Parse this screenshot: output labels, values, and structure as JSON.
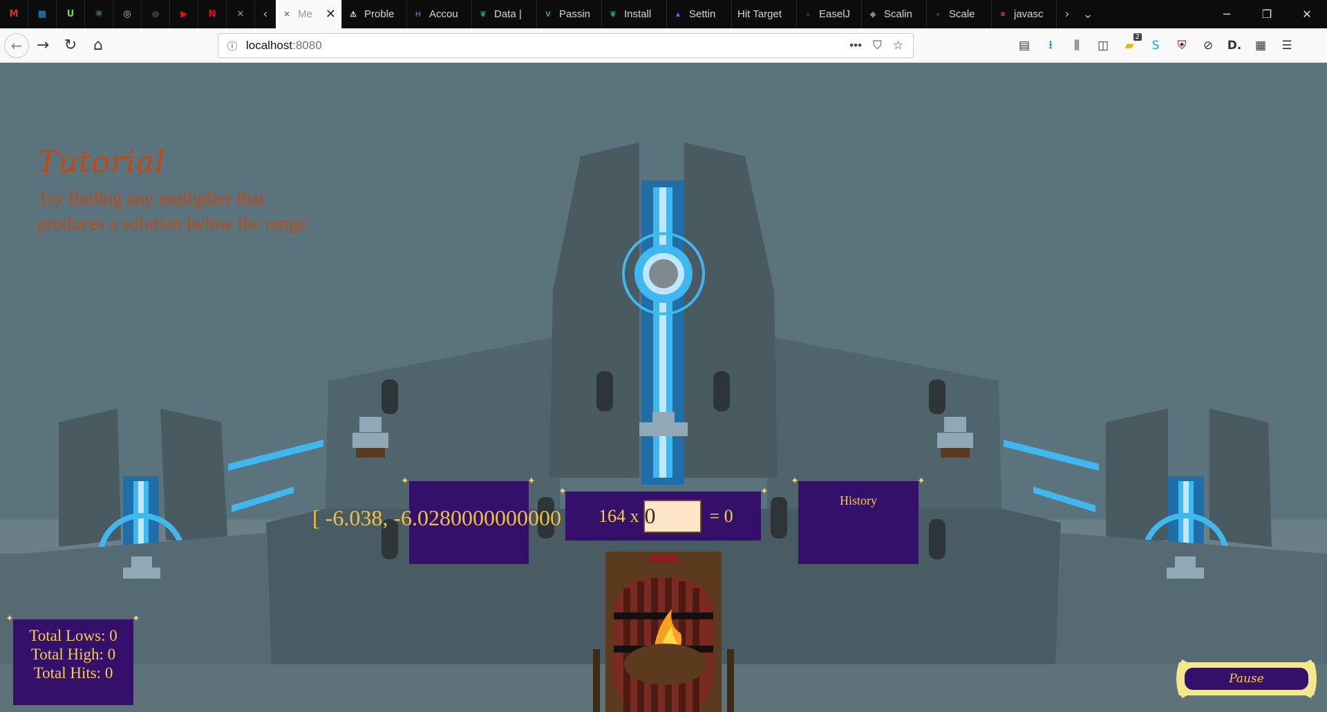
{
  "browser": {
    "pinned_tabs": [
      {
        "name": "gmail",
        "icon": "gmail-icon",
        "color": "#d93025",
        "glyph": "M"
      },
      {
        "name": "microsoft",
        "icon": "microsoft-icon",
        "color": "#00a4ef",
        "glyph": "▦"
      },
      {
        "name": "upwork",
        "icon": "upwork-icon",
        "color": "#6fda44",
        "glyph": "U"
      },
      {
        "name": "react",
        "icon": "react-icon",
        "color": "#61dafb",
        "glyph": "⚛"
      },
      {
        "name": "globe",
        "icon": "globe-icon",
        "color": "#cccccc",
        "glyph": "◎"
      },
      {
        "name": "github",
        "icon": "github-icon",
        "color": "#333333",
        "glyph": "●"
      },
      {
        "name": "youtube",
        "icon": "youtube-icon",
        "color": "#ff0000",
        "glyph": "▶"
      },
      {
        "name": "netflix",
        "icon": "netflix-icon",
        "color": "#e50914",
        "glyph": "N"
      },
      {
        "name": "close-tabs",
        "icon": "cross-icon",
        "color": "#9a9a9a",
        "glyph": "✕"
      }
    ],
    "tabs": [
      {
        "label": "Me",
        "icon": "cross-icon",
        "color": "#777777",
        "glyph": "✕",
        "active": true
      },
      {
        "label": "Proble",
        "icon": "warning-icon",
        "color": "#f5f5f5",
        "glyph": "⚠"
      },
      {
        "label": "Accou",
        "icon": "heroku-icon",
        "color": "#79589f",
        "glyph": "H"
      },
      {
        "label": "Data |",
        "icon": "mongodb-icon",
        "color": "#13aa52",
        "glyph": "❦"
      },
      {
        "label": "Passin",
        "icon": "vue-icon",
        "color": "#41b883",
        "glyph": "V"
      },
      {
        "label": "Install",
        "icon": "mongodb-icon",
        "color": "#13aa52",
        "glyph": "❦"
      },
      {
        "label": "Settin",
        "icon": "rocket-icon",
        "color": "#7c4dff",
        "glyph": "▲"
      },
      {
        "label": "Hit Target",
        "icon": "none",
        "color": "#0c0c0d",
        "glyph": ""
      },
      {
        "label": "EaselJ",
        "icon": "github-icon",
        "color": "#333333",
        "glyph": "●"
      },
      {
        "label": "Scalin",
        "icon": "cube-icon",
        "color": "#888888",
        "glyph": "◆"
      },
      {
        "label": "Scale",
        "icon": "github-icon",
        "color": "#333333",
        "glyph": "●"
      },
      {
        "label": "javasc",
        "icon": "stackoverflow-icon",
        "color": "#f48024",
        "glyph": "≡"
      }
    ],
    "url_host": "localhost",
    "url_port": ":8080",
    "downloads_badge": "2"
  },
  "tutorial": {
    "title": "Tutorial",
    "text": "Try finding any multiplier that produces a solution below the range"
  },
  "game": {
    "range_text": "[ -6.038, -6.0280000000000",
    "multiplicand": "164 x",
    "multiplier_value": "0",
    "result": "= 0",
    "history_label": "History",
    "stats": {
      "lows": "Total Lows: 0",
      "high": "Total High: 0",
      "hits": "Total Hits: 0"
    },
    "pause_label": "Pause"
  },
  "colors": {
    "background": "#5a737d",
    "panel": "#35106a",
    "gold": "#f6cf4a",
    "tutorial": "#c14a12",
    "beam": "#3fb8f0"
  }
}
